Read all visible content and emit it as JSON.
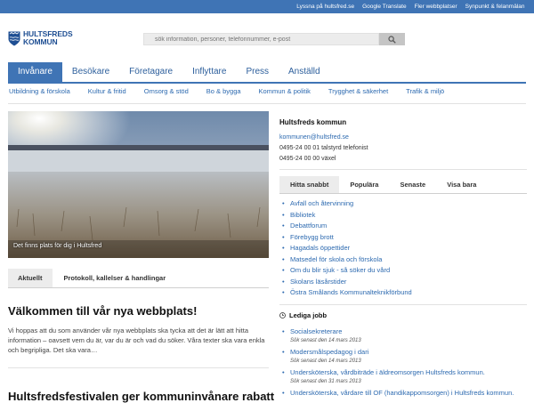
{
  "toplinks": [
    "Lyssna på hultsfred.se",
    "Google Translate",
    "Fler webbplatser",
    "Synpunkt & felanmälan"
  ],
  "logo": {
    "line1": "HULTSFREDS",
    "line2": "KOMMUN"
  },
  "search": {
    "placeholder": "sök information, personer, telefonnummer, e-post"
  },
  "mainnav": [
    "Invånare",
    "Besökare",
    "Företagare",
    "Inflyttare",
    "Press",
    "Anställd"
  ],
  "subnav": [
    "Utbildning & förskola",
    "Kultur & fritid",
    "Omsorg & stöd",
    "Bo & bygga",
    "Kommun & politik",
    "Trygghet & säkerhet",
    "Trafik & miljö"
  ],
  "hero": {
    "caption": "Det finns plats för dig i Hultsfred"
  },
  "tabs": [
    "Aktuellt",
    "Protokoll, kallelser & handlingar"
  ],
  "news": [
    {
      "title": "Välkommen till vår nya webbplats!",
      "text": "Vi hoppas att du som använder vår nya webbplats ska tycka att det är lätt att hitta information – oavsett vem du är, var du är och vad du söker. Våra texter ska vara enkla och begripliga. Det ska vara…"
    },
    {
      "title": "Hultsfredsfestivalen ger kommuninvånare rabatt"
    }
  ],
  "contact": {
    "title": "Hultsfreds kommun",
    "email": "kommunen@hultsfred.se",
    "phone1": "0495-24 00 01 talstyrd telefonist",
    "phone2": "0495-24 00 00 växel"
  },
  "rtabs": [
    "Hitta snabbt",
    "Populära",
    "Senaste",
    "Visa bara"
  ],
  "quicklinks": [
    "Avfall och återvinning",
    "Bibliotek",
    "Debattforum",
    "Förebygg brott",
    "Hagadals öppettider",
    "Matsedel för skola och förskola",
    "Om du blir sjuk - så söker du vård",
    "Skolans läsårstider",
    "Östra Smålands Kommunalteknikförbund"
  ],
  "jobs": {
    "title": "Lediga jobb",
    "items": [
      {
        "name": "Socialsekreterare",
        "date": "Sök senast den 14 mars 2013"
      },
      {
        "name": "Modersmålspedagog i dari",
        "date": "Sök senast den 14 mars 2013"
      },
      {
        "name": "Undersköterska, vårdbiträde i äldreomsorgen Hultsfreds kommun.",
        "date": "Sök senast den 31 mars 2013"
      },
      {
        "name": "Undersköterska, vårdare till OF (handikappomsorgen) i Hultsfreds kommun.",
        "date": ""
      }
    ]
  },
  "colors": {
    "brand": "#3f74b5",
    "link": "#2d6ab0"
  }
}
